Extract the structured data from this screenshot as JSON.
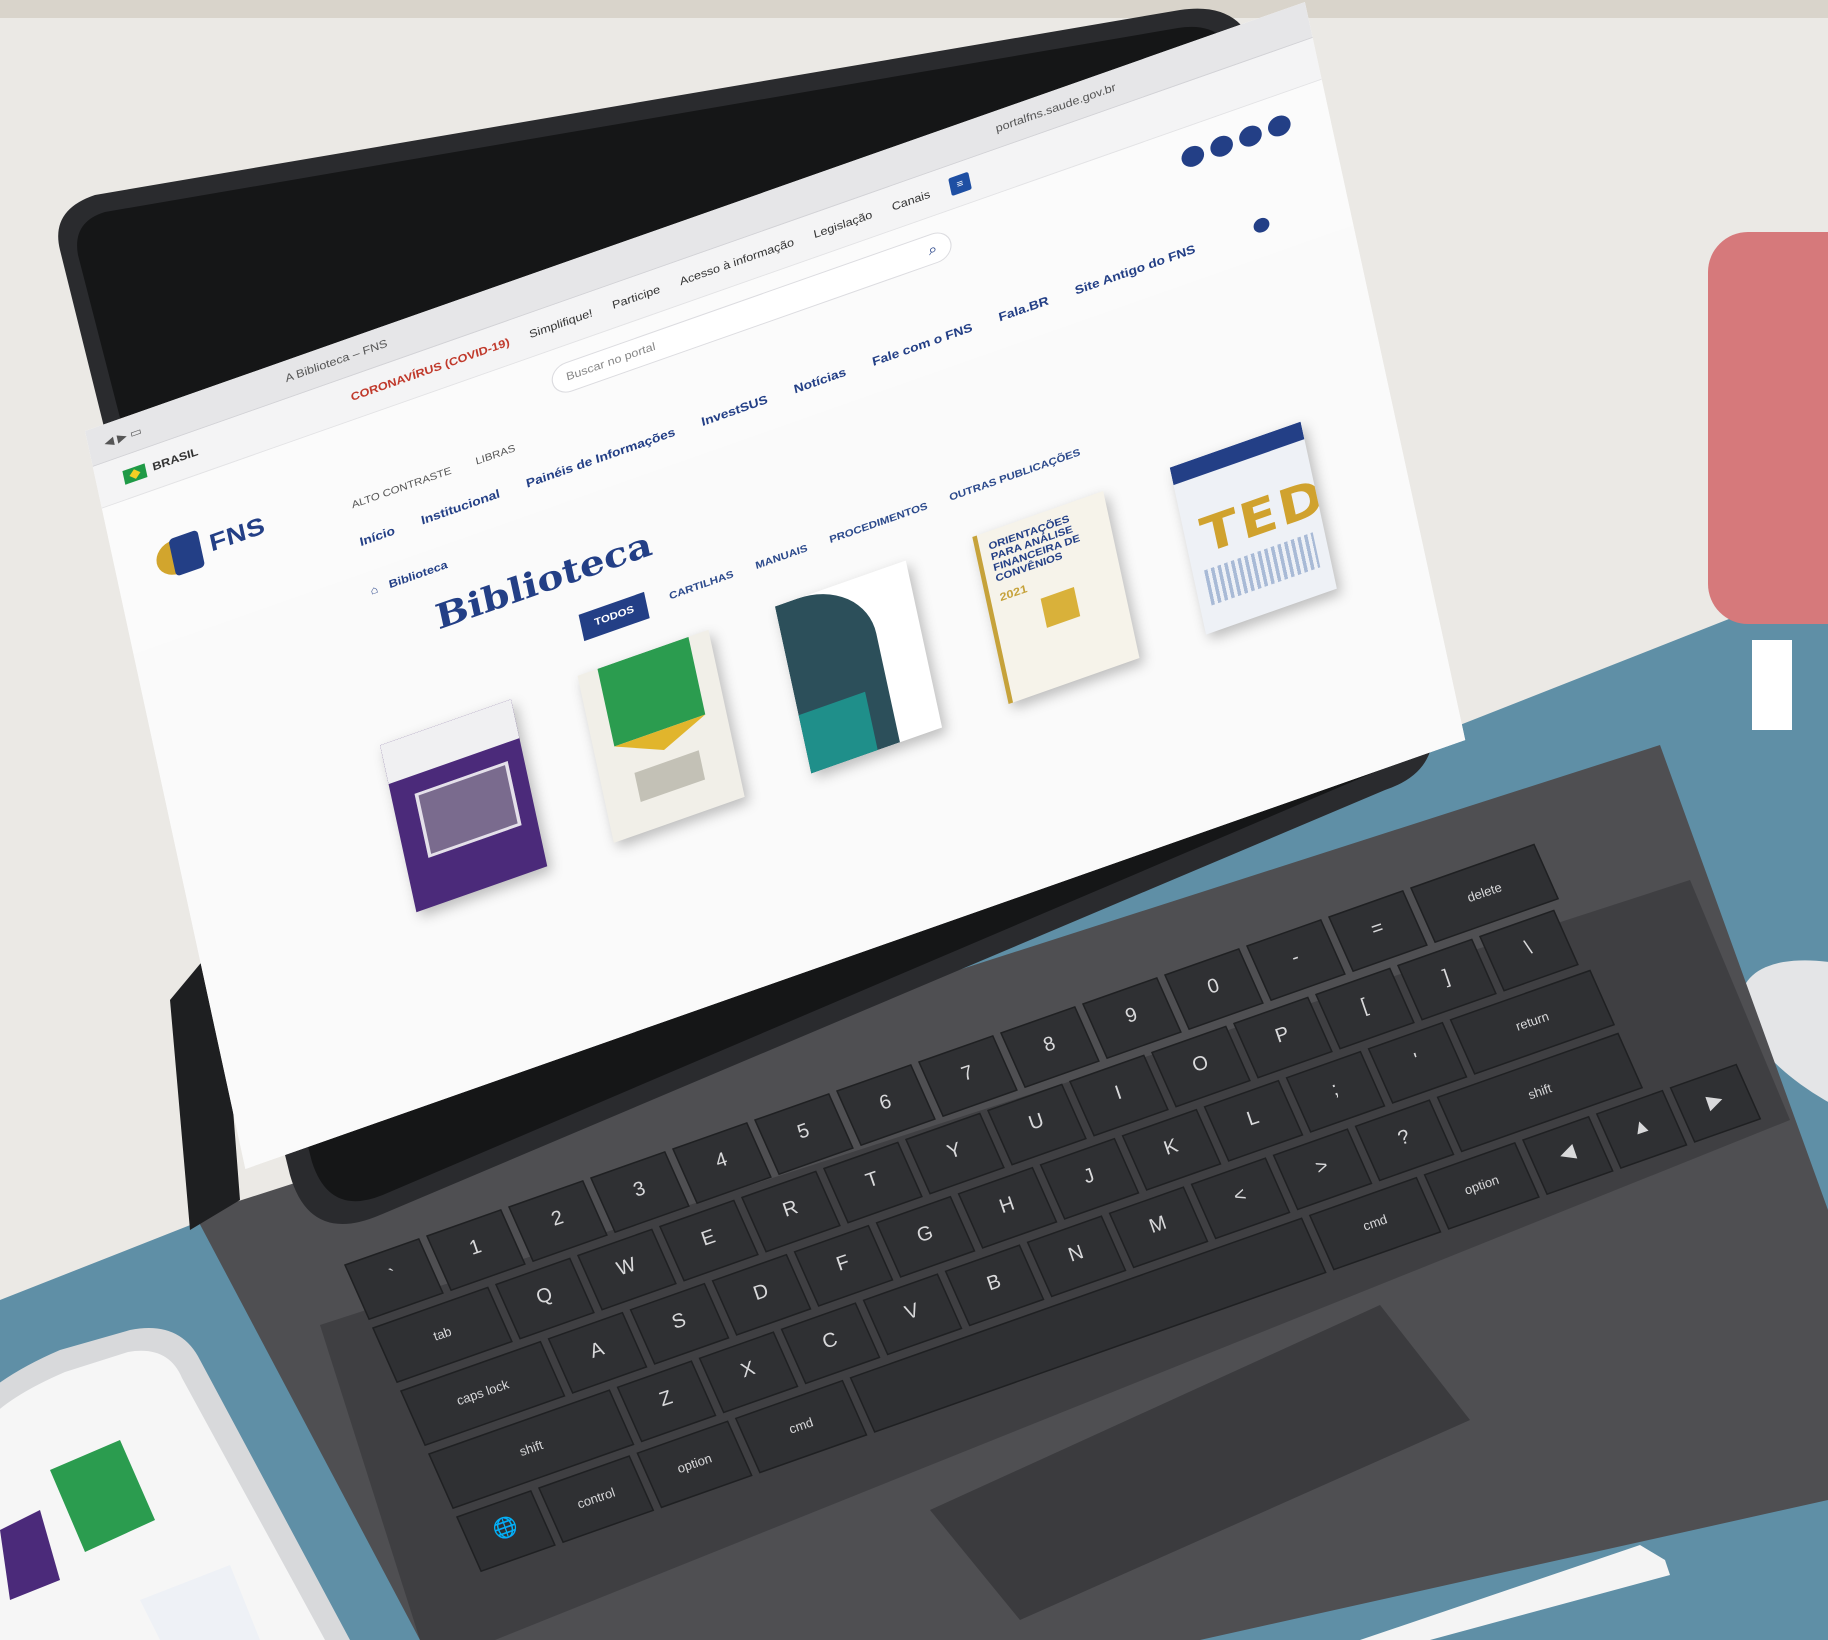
{
  "browser": {
    "tab_title": "A Biblioteca – FNS",
    "url": "portalfns.saude.gov.br"
  },
  "gov_bar": {
    "country": "BRASIL",
    "covid_link": "CORONAVÍRUS (COVID-19)",
    "links": [
      "Simplifique!",
      "Participe",
      "Acesso à informação",
      "Legislação",
      "Canais"
    ]
  },
  "header": {
    "logo_text": "FNS",
    "search_placeholder": "Buscar no portal",
    "utility": [
      "ALTO CONTRASTE",
      "LIBRAS"
    ],
    "nav": [
      "Início",
      "Institucional",
      "Painéis de Informações",
      "InvestSUS",
      "Notícias",
      "Fale com o FNS",
      "Fala.BR",
      "Site Antigo do FNS"
    ]
  },
  "content": {
    "breadcrumb_current": "Biblioteca",
    "page_title": "Biblioteca",
    "filters": [
      "TODOS",
      "CARTILHAS",
      "MANUAIS",
      "PROCEDIMENTOS",
      "OUTRAS PUBLICAÇÕES"
    ],
    "books": [
      {
        "id": "book-purple"
      },
      {
        "id": "book-green-flag"
      },
      {
        "id": "book-teal"
      },
      {
        "id": "book-orientacoes",
        "title": "ORIENTAÇÕES PARA ANÁLISE FINANCEIRA DE CONVÊNIOS",
        "year": "2021"
      },
      {
        "id": "book-ted",
        "title": "TED"
      }
    ]
  },
  "keyboard": {
    "number_row": [
      "~",
      "!",
      "@",
      "#",
      "$",
      "%",
      "^",
      "&",
      "*",
      "(",
      ")",
      "_",
      "+",
      "delete"
    ],
    "number_row_main": [
      "`",
      "1",
      "2",
      "3",
      "4",
      "5",
      "6",
      "7",
      "8",
      "9",
      "0",
      "-",
      "="
    ],
    "row_q": [
      "tab",
      "Q",
      "W",
      "E",
      "R",
      "T",
      "Y",
      "U",
      "I",
      "O",
      "P",
      "[",
      "]",
      "\\"
    ],
    "row_a": [
      "caps lock",
      "A",
      "S",
      "D",
      "F",
      "G",
      "H",
      "J",
      "K",
      "L",
      ";",
      "'",
      "return"
    ],
    "row_z": [
      "shift",
      "Z",
      "X",
      "C",
      "V",
      "B",
      "N",
      "M",
      "<",
      ">",
      "?",
      "shift"
    ],
    "row_bottom": [
      "🌐",
      "control",
      "option",
      "cmd",
      "cmd",
      "option"
    ],
    "cmd_symbol": "⌘",
    "option_symbol": "⌥",
    "control_symbol": "^"
  },
  "colors": {
    "wall": "#ebe9e5",
    "desk": "#5f8fa6",
    "tablet_frame": "#2a2b2e",
    "keyboard_body": "#4f4f52",
    "key": "#2f3033",
    "fns_blue": "#233f86",
    "fns_gold": "#d2a52d",
    "badge_pink": "#d6797b"
  }
}
